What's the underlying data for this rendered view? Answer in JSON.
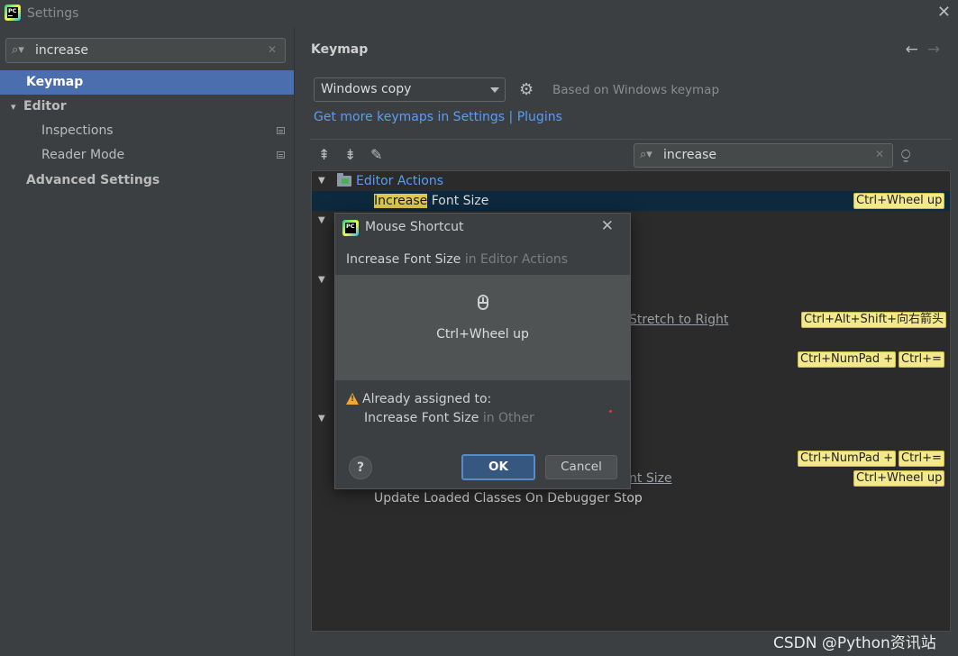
{
  "window": {
    "title": "Settings",
    "close_glyph": "✕"
  },
  "sidebar": {
    "search_value": "increase",
    "items": [
      {
        "label": "Keymap"
      },
      {
        "label": "Editor"
      },
      {
        "label": "Inspections"
      },
      {
        "label": "Reader Mode"
      },
      {
        "label": "Advanced Settings"
      }
    ]
  },
  "main": {
    "title": "Keymap",
    "keymap_select": "Windows copy",
    "based_on": "Based on Windows keymap",
    "link": "Get more keymaps in Settings | Plugins",
    "search_value": "increase",
    "group": "Editor Actions",
    "rows": {
      "r1_highlight": "Increase",
      "r1_rest": " Font Size",
      "r1_shortcut": "Ctrl+Wheel up",
      "r2_text": "Stretch to Right",
      "r2_shortcut": "Ctrl+Alt+Shift+向右箭头",
      "r3_shortcut1": "Ctrl+NumPad +",
      "r3_shortcut2": "Ctrl+=",
      "r4_shortcut1": "Ctrl+NumPad +",
      "r4_shortcut2": "Ctrl+=",
      "r5_text": "nt Size",
      "r5_shortcut": "Ctrl+Wheel up",
      "r6_text": "Update Loaded Classes On Debugger Stop"
    }
  },
  "dialog": {
    "title": "Mouse Shortcut",
    "action_name": "Increase Font Size",
    "action_context": " in Editor Actions",
    "shortcut": "Ctrl+Wheel up",
    "warning": "Already assigned to:",
    "conflict_name": "Increase Font Size",
    "conflict_context": " in Other",
    "help": "?",
    "ok": "OK",
    "cancel": "Cancel"
  },
  "watermark": "CSDN @Python资讯站"
}
